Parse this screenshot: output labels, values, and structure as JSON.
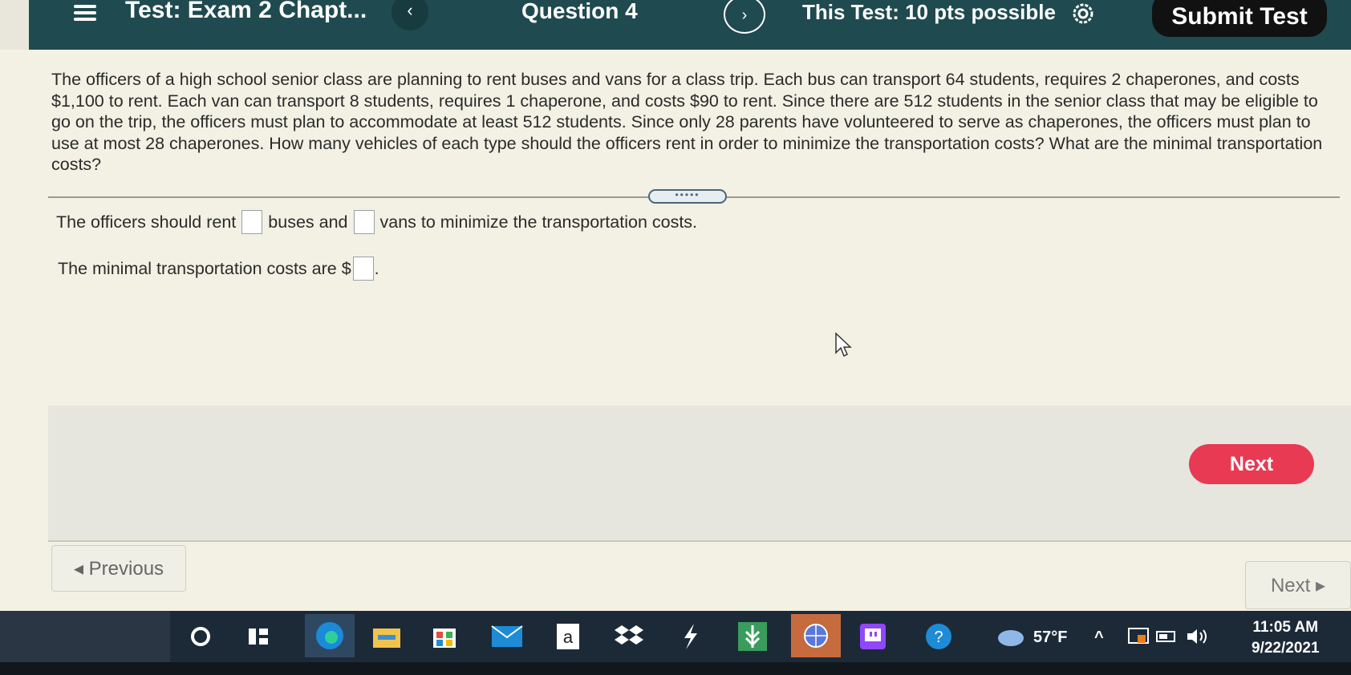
{
  "header": {
    "test_title": "Test: Exam 2 Chapt...",
    "prev_glyph": "‹",
    "question_label": "Question 4",
    "next_glyph": "›",
    "points_label": "This Test: 10 pts possible",
    "settings_icon": "gear-icon",
    "submit_label": "Submit Test"
  },
  "question": {
    "text": "The officers of a high school senior class are planning to rent buses and vans for a class trip. Each bus can transport 64 students, requires 2 chaperones, and costs $1,100 to rent. Each van can transport 8 students, requires 1 chaperone, and costs $90 to rent. Since there are 512 students in the senior class that may be eligible to go on the trip, the officers must plan to accommodate at least 512 students. Since only 28 parents have volunteered to serve as chaperones, the officers must plan to use at most 28 chaperones. How many vehicles of each type should the officers rent in order to minimize the transportation costs? What are the minimal transportation costs?",
    "expand_handle": "•••••"
  },
  "answer": {
    "line1_part1": "The officers should rent",
    "buses_value": "",
    "line1_part2": "buses and",
    "vans_value": "",
    "line1_part3": "vans to minimize the transportation costs.",
    "line2_part1": "The minimal transportation costs are $",
    "cost_value": "",
    "line2_part2": "."
  },
  "navigation": {
    "next_label": "Next",
    "previous_label": "◂ Previous",
    "next_bottom_label": "Next ▸"
  },
  "taskbar": {
    "weather": "57°F",
    "time": "11:05 AM",
    "date": "9/22/2021",
    "icons": [
      "cortana-icon",
      "task-view-icon",
      "edge-icon",
      "file-explorer-icon",
      "store-icon",
      "mail-icon",
      "amazon-icon",
      "dropbox-icon",
      "app-icon",
      "leaf-app-icon",
      "globe-icon",
      "twitch-icon",
      "help-icon"
    ]
  },
  "colors": {
    "header_bg": "#1f4a4f",
    "next_button": "#e83a52",
    "submit_button": "#111111"
  }
}
